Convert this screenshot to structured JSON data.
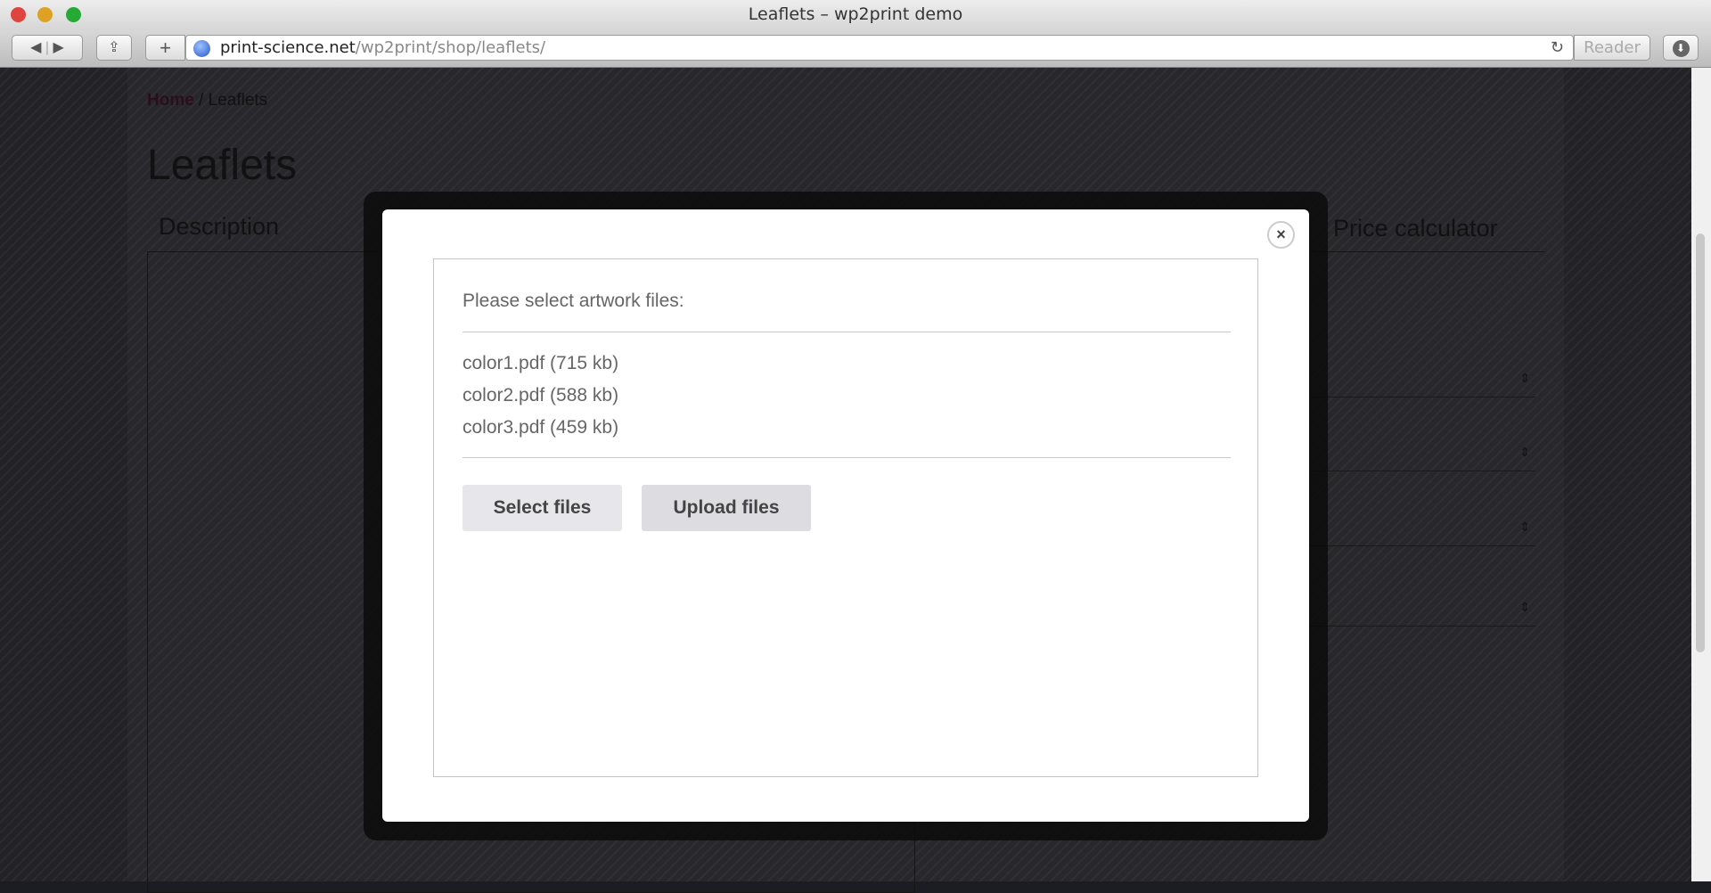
{
  "window": {
    "title": "Leaflets – wp2print demo"
  },
  "toolbar": {
    "url_domain": "print-science.net",
    "url_path": "/wp2print/shop/leaflets/",
    "reader_label": "Reader",
    "add_label": "+"
  },
  "page": {
    "breadcrumb_home": "Home",
    "breadcrumb_sep": "/",
    "breadcrumb_current": "Leaflets",
    "title": "Leaflets",
    "tab_description": "Description",
    "tab_price": "Price calculator"
  },
  "modal": {
    "close_label": "×",
    "prompt": "Please select artwork files:",
    "files": [
      {
        "label": "color1.pdf (715 kb)"
      },
      {
        "label": "color2.pdf (588 kb)"
      },
      {
        "label": "color3.pdf (459 kb)"
      }
    ],
    "select_button": "Select files",
    "upload_button": "Upload files"
  }
}
